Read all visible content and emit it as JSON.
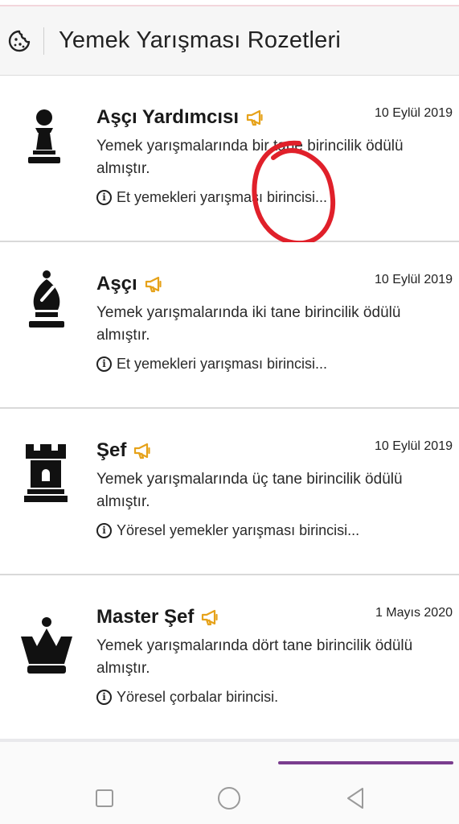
{
  "header": {
    "title": "Yemek Yarışması Rozetleri",
    "icon": "cookie-icon"
  },
  "badges": [
    {
      "name": "Aşçı Yardımcısı",
      "date": "10 Eylül 2019",
      "description": "Yemek yarışmalarında bir tane birincilik ödülü almıştır.",
      "info": "Et yemekleri yarışması birincisi...",
      "icon": "chess-pawn-icon"
    },
    {
      "name": "Aşçı",
      "date": "10 Eylül 2019",
      "description": "Yemek yarışmalarında iki tane birincilik ödülü almıştır.",
      "info": "Et yemekleri yarışması birincisi...",
      "icon": "chess-bishop-icon"
    },
    {
      "name": "Şef",
      "date": "10 Eylül 2019",
      "description": "Yemek yarışmalarında üç tane birincilik ödülü almıştır.",
      "info": "Yöresel yemekler yarışması birincisi...",
      "icon": "chess-rook-icon"
    },
    {
      "name": "Master Şef",
      "date": "1 Mayıs 2020",
      "description": "Yemek yarışmalarında dört tane birincilik ödülü almıştır.",
      "info": "Yöresel çorbalar birincisi.",
      "icon": "chess-queen-icon"
    }
  ],
  "colors": {
    "megaphone": "#e6a21a",
    "annotation": "#e0202a",
    "accent_bar": "#7a3d8e"
  },
  "nav": {
    "recents": "square-icon",
    "home": "circle-icon",
    "back": "triangle-back-icon"
  }
}
